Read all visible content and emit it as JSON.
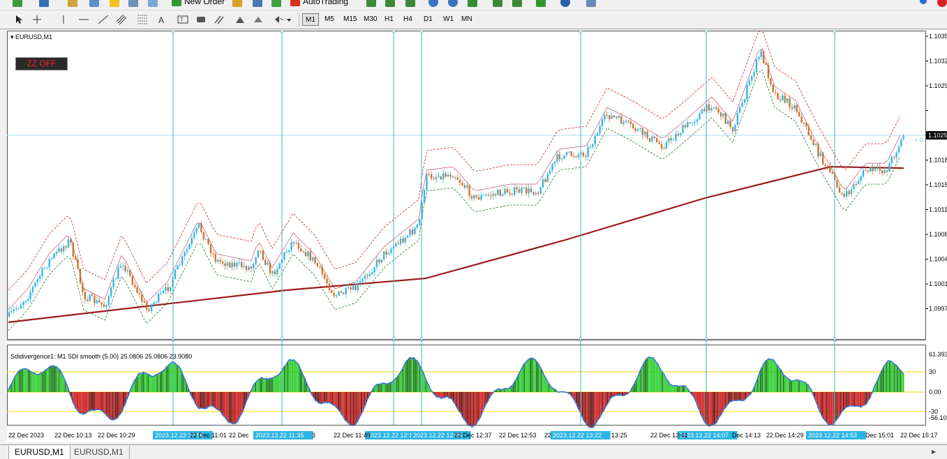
{
  "toolbar_top": {
    "new_order": "New Order",
    "autotrading": "AutoTrading"
  },
  "timeframes": [
    {
      "label": "M1",
      "active": true
    },
    {
      "label": "M5",
      "active": false
    },
    {
      "label": "M15",
      "active": false
    },
    {
      "label": "M30",
      "active": false
    },
    {
      "label": "H1",
      "active": false
    },
    {
      "label": "H4",
      "active": false
    },
    {
      "label": "D1",
      "active": false
    },
    {
      "label": "W1",
      "active": false
    },
    {
      "label": "MN",
      "active": false
    }
  ],
  "chart": {
    "symbol_label": "EURUSD,M1",
    "zz_button": "ZZ OFF",
    "current_price": "1.1025",
    "price_arrow_text": "< 0",
    "price_ticks": [
      "1.1035",
      "1.1032",
      "1.1029",
      "1.1025",
      "1.1022",
      "1.1018",
      "1.1015",
      "1.1011",
      "1.1008",
      "1.1004",
      "1.1001",
      "1.0997"
    ],
    "time_labels": [
      "22 Dec 2023",
      "22 Dec 10:13",
      "22 Dec 10:29",
      "22 Dec 11:01",
      "22 Dec",
      "3",
      "22 Dec 11:49",
      "22 Dec 12:37",
      "22 Dec 12:53",
      "22",
      "13:25",
      "22 Dec 13:41",
      "Dec 14:13",
      "22 Dec 14:29",
      "Dec 15:01",
      "22 Dec 15:17"
    ],
    "time_markers": [
      "2023.12.22 10:56",
      "2023.12.22 11:35",
      "2023.12.22 12:15",
      "2023.12.22 12:25",
      "2023.12.22 13:22",
      "2023.12.22 14:07",
      "2023.12.22 14:53"
    ]
  },
  "indicator": {
    "title": "Sdidivergence1:  M1    SDI smooth (5.00) 25.0806 25.0806 23.9080",
    "levels": [
      "61.393",
      "30",
      "0.00",
      "-30",
      "-56.108"
    ]
  },
  "tabs": [
    {
      "label": "EURUSD,M1",
      "active": true
    },
    {
      "label": "EURUSD,M1",
      "active": false
    }
  ],
  "colors": {
    "bull_candle": "#35b5e5",
    "bear_candle": "#c87533",
    "ma_line": "#9b1b1b",
    "env_upper": "#d81b1b",
    "env_lower": "#1a7a1a",
    "marker_line": "#3bb3c8",
    "hist_green": "#22cc22",
    "hist_red": "#cc1111",
    "level_line": "#e8d800"
  }
}
